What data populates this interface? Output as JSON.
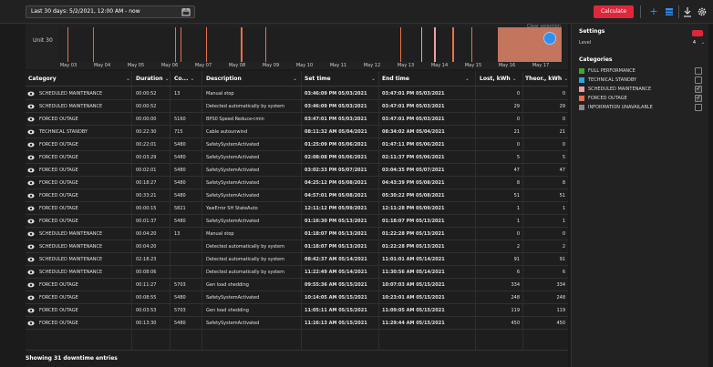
{
  "toolbar": {
    "date_range": "Last 30 days: 5/2/2021, 12:00 AM - now",
    "calendar_icon": "calendar-icon",
    "calculate_label": "Calculate",
    "icons": [
      "plus-icon",
      "table-icon",
      "download-icon",
      "gear-icon"
    ],
    "accent": "#e0263b",
    "blue": "#2f8ff0"
  },
  "timeline": {
    "row_label": "Unit 30",
    "clear_selection": "Clear selection",
    "ticks": [
      "May 03",
      "May 04",
      "May 05",
      "May 06",
      "May 07",
      "May 08",
      "May 09",
      "May 10",
      "May 11",
      "May 12",
      "May 13",
      "May 14",
      "May 15",
      "May 16",
      "May 17"
    ]
  },
  "table": {
    "columns": [
      "Category",
      "Duration",
      "Co...",
      "Description",
      "Set time",
      "End time",
      "Lost, kWh",
      "Theor., kWh"
    ],
    "rows": [
      {
        "category": "SCHEDULED MAINTENANCE",
        "duration": "00:00:52",
        "code": "13",
        "description": "Manual stop",
        "set_time": "03:46:09 PM 05/03/2021",
        "end_time": "03:47:01 PM 05/03/2021",
        "lost": "0",
        "theor": "0"
      },
      {
        "category": "SCHEDULED MAINTENANCE",
        "duration": "00:00:52",
        "code": "",
        "description": "Detected automatically by system",
        "set_time": "03:46:09 PM 05/03/2021",
        "end_time": "03:47:01 PM 05/03/2021",
        "lost": "29",
        "theor": "29"
      },
      {
        "category": "FORCED OUTAGE",
        "duration": "00:00:00",
        "code": "5160",
        "description": "BPS0 Speed Reduce<min",
        "set_time": "03:47:01 PM 05/03/2021",
        "end_time": "03:47:01 PM 05/03/2021",
        "lost": "0",
        "theor": "0"
      },
      {
        "category": "TECHNICAL STANDBY",
        "duration": "00:22:30",
        "code": "715",
        "description": "Cable autounwind",
        "set_time": "08:11:32 AM 05/04/2021",
        "end_time": "08:34:02 AM 05/04/2021",
        "lost": "21",
        "theor": "21"
      },
      {
        "category": "FORCED OUTAGE",
        "duration": "00:22:01",
        "code": "5480",
        "description": "SafetySystemActivated",
        "set_time": "01:25:09 PM 05/06/2021",
        "end_time": "01:47:11 PM 05/06/2021",
        "lost": "0",
        "theor": "0"
      },
      {
        "category": "FORCED OUTAGE",
        "duration": "00:03:29",
        "code": "5480",
        "description": "SafetySystemActivated",
        "set_time": "02:08:08 PM 05/06/2021",
        "end_time": "02:11:37 PM 05/06/2021",
        "lost": "5",
        "theor": "5"
      },
      {
        "category": "FORCED OUTAGE",
        "duration": "00:02:01",
        "code": "5480",
        "description": "SafetySystemActivated",
        "set_time": "03:02:33 PM 05/07/2021",
        "end_time": "03:04:35 PM 05/07/2021",
        "lost": "47",
        "theor": "47"
      },
      {
        "category": "FORCED OUTAGE",
        "duration": "00:18:27",
        "code": "5480",
        "description": "SafetySystemActivated",
        "set_time": "04:25:12 PM 05/08/2021",
        "end_time": "04:43:39 PM 05/08/2021",
        "lost": "8",
        "theor": "8"
      },
      {
        "category": "FORCED OUTAGE",
        "duration": "00:33:21",
        "code": "5480",
        "description": "SafetySystemActivated",
        "set_time": "04:57:01 PM 05/08/2021",
        "end_time": "05:30:22 PM 05/08/2021",
        "lost": "51",
        "theor": "51"
      },
      {
        "category": "FORCED OUTAGE",
        "duration": "00:00:15",
        "code": "5821",
        "description": "YawError SH StateAuto",
        "set_time": "12:11:12 PM 05/09/2021",
        "end_time": "12:11:28 PM 05/09/2021",
        "lost": "1",
        "theor": "1"
      },
      {
        "category": "FORCED OUTAGE",
        "duration": "00:01:37",
        "code": "5480",
        "description": "SafetySystemActivated",
        "set_time": "01:16:30 PM 05/13/2021",
        "end_time": "01:18:07 PM 05/13/2021",
        "lost": "1",
        "theor": "1"
      },
      {
        "category": "SCHEDULED MAINTENANCE",
        "duration": "00:04:20",
        "code": "13",
        "description": "Manual stop",
        "set_time": "01:18:07 PM 05/13/2021",
        "end_time": "01:22:28 PM 05/13/2021",
        "lost": "0",
        "theor": "0"
      },
      {
        "category": "SCHEDULED MAINTENANCE",
        "duration": "00:04:20",
        "code": "",
        "description": "Detected automatically by system",
        "set_time": "01:18:07 PM 05/13/2021",
        "end_time": "01:22:28 PM 05/13/2021",
        "lost": "2",
        "theor": "2"
      },
      {
        "category": "SCHEDULED MAINTENANCE",
        "duration": "02:18:23",
        "code": "",
        "description": "Detected automatically by system",
        "set_time": "08:42:37 AM 05/14/2021",
        "end_time": "11:01:01 AM 05/14/2021",
        "lost": "91",
        "theor": "91"
      },
      {
        "category": "SCHEDULED MAINTENANCE",
        "duration": "00:08:06",
        "code": "",
        "description": "Detected automatically by system",
        "set_time": "11:22:49 AM 05/14/2021",
        "end_time": "11:30:56 AM 05/14/2021",
        "lost": "6",
        "theor": "6"
      },
      {
        "category": "FORCED OUTAGE",
        "duration": "00:11:27",
        "code": "5703",
        "description": "Gen load shedding",
        "set_time": "09:55:36 AM 05/15/2021",
        "end_time": "10:07:03 AM 05/15/2021",
        "lost": "334",
        "theor": "334"
      },
      {
        "category": "FORCED OUTAGE",
        "duration": "00:08:55",
        "code": "5480",
        "description": "SafetySystemActivated",
        "set_time": "10:14:05 AM 05/15/2021",
        "end_time": "10:23:01 AM 05/15/2021",
        "lost": "248",
        "theor": "248"
      },
      {
        "category": "FORCED OUTAGE",
        "duration": "00:03:53",
        "code": "5703",
        "description": "Gen load shedding",
        "set_time": "11:05:11 AM 05/15/2021",
        "end_time": "11:09:05 AM 05/15/2021",
        "lost": "119",
        "theor": "119"
      },
      {
        "category": "FORCED OUTAGE",
        "duration": "00:13:30",
        "code": "5480",
        "description": "SafetySystemActivated",
        "set_time": "11:16:13 AM 05/15/2021",
        "end_time": "11:29:44 AM 05/15/2021",
        "lost": "450",
        "theor": "450"
      }
    ]
  },
  "footer": {
    "summary": "Showing 31 downtime entries"
  },
  "panel": {
    "settings_title": "Settings",
    "level_label": "Level",
    "level_value": "4",
    "categories_title": "Categories",
    "categories": [
      {
        "label": "FULL PERFORMANCE",
        "color": "#3fa535",
        "checked": false
      },
      {
        "label": "TECHNICAL STANDBY",
        "color": "#2aa5e0",
        "checked": false
      },
      {
        "label": "SCHEDULED MAINTENANCE",
        "color": "#f0a0a0",
        "checked": true
      },
      {
        "label": "FORCED OUTAGE",
        "color": "#e8704a",
        "checked": true
      },
      {
        "label": "INFORMATION UNAVAILABLE",
        "color": "#8a8a8a",
        "checked": false
      }
    ]
  }
}
